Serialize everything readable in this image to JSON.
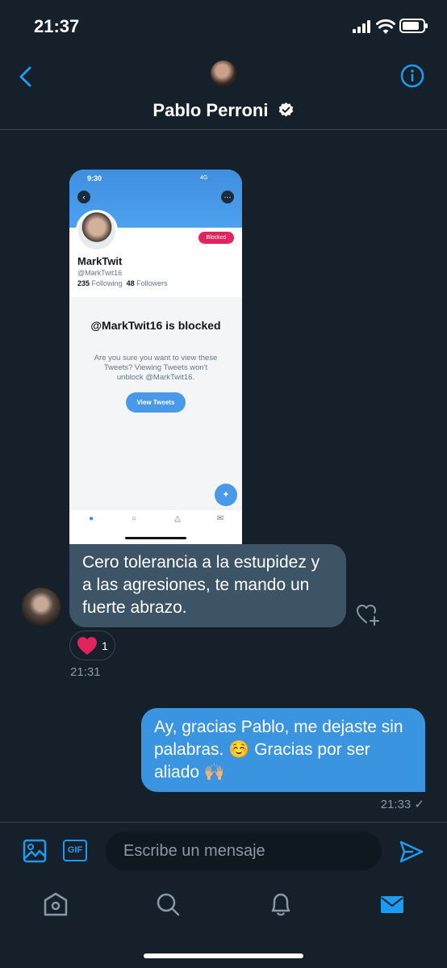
{
  "status_bar": {
    "time": "21:37"
  },
  "header": {
    "name": "Pablo Perroni",
    "verified": true
  },
  "shared_image": {
    "time": "9:30",
    "network": "4G",
    "blocked_badge": "Blocked",
    "profile_name": "MarkTwit",
    "handle": "@MarkTwit16",
    "following_count": "235",
    "following_label": "Following",
    "followers_count": "48",
    "followers_label": "Followers",
    "blocked_title": "@MarkTwit16 is blocked",
    "blocked_text": "Are you sure you want to view these Tweets? Viewing Tweets won't unblock @MarkTwit16.",
    "view_button": "View Tweets"
  },
  "incoming": {
    "text": "Cero tolerancia a la estupidez y a las agresiones, te mando un fuerte abrazo.",
    "reaction_count": "1",
    "time": "21:31"
  },
  "outgoing": {
    "text": "Ay, gracias Pablo, me dejaste sin palabras. ☺️ Gracias por ser aliado 🙌🏼",
    "time": "21:33 ✓"
  },
  "composer": {
    "gif_label": "GIF",
    "placeholder": "Escribe un mensaje"
  },
  "colors": {
    "accent": "#1d9bf0",
    "background": "#15202b",
    "incoming_bubble": "#3d5466",
    "outgoing_bubble": "#3b94e0"
  },
  "icons": [
    "back-arrow-icon",
    "info-icon",
    "verified-badge-icon",
    "like-icon",
    "heart-icon",
    "image-icon",
    "send-icon",
    "home-icon",
    "search-icon",
    "bell-icon",
    "mail-icon"
  ]
}
